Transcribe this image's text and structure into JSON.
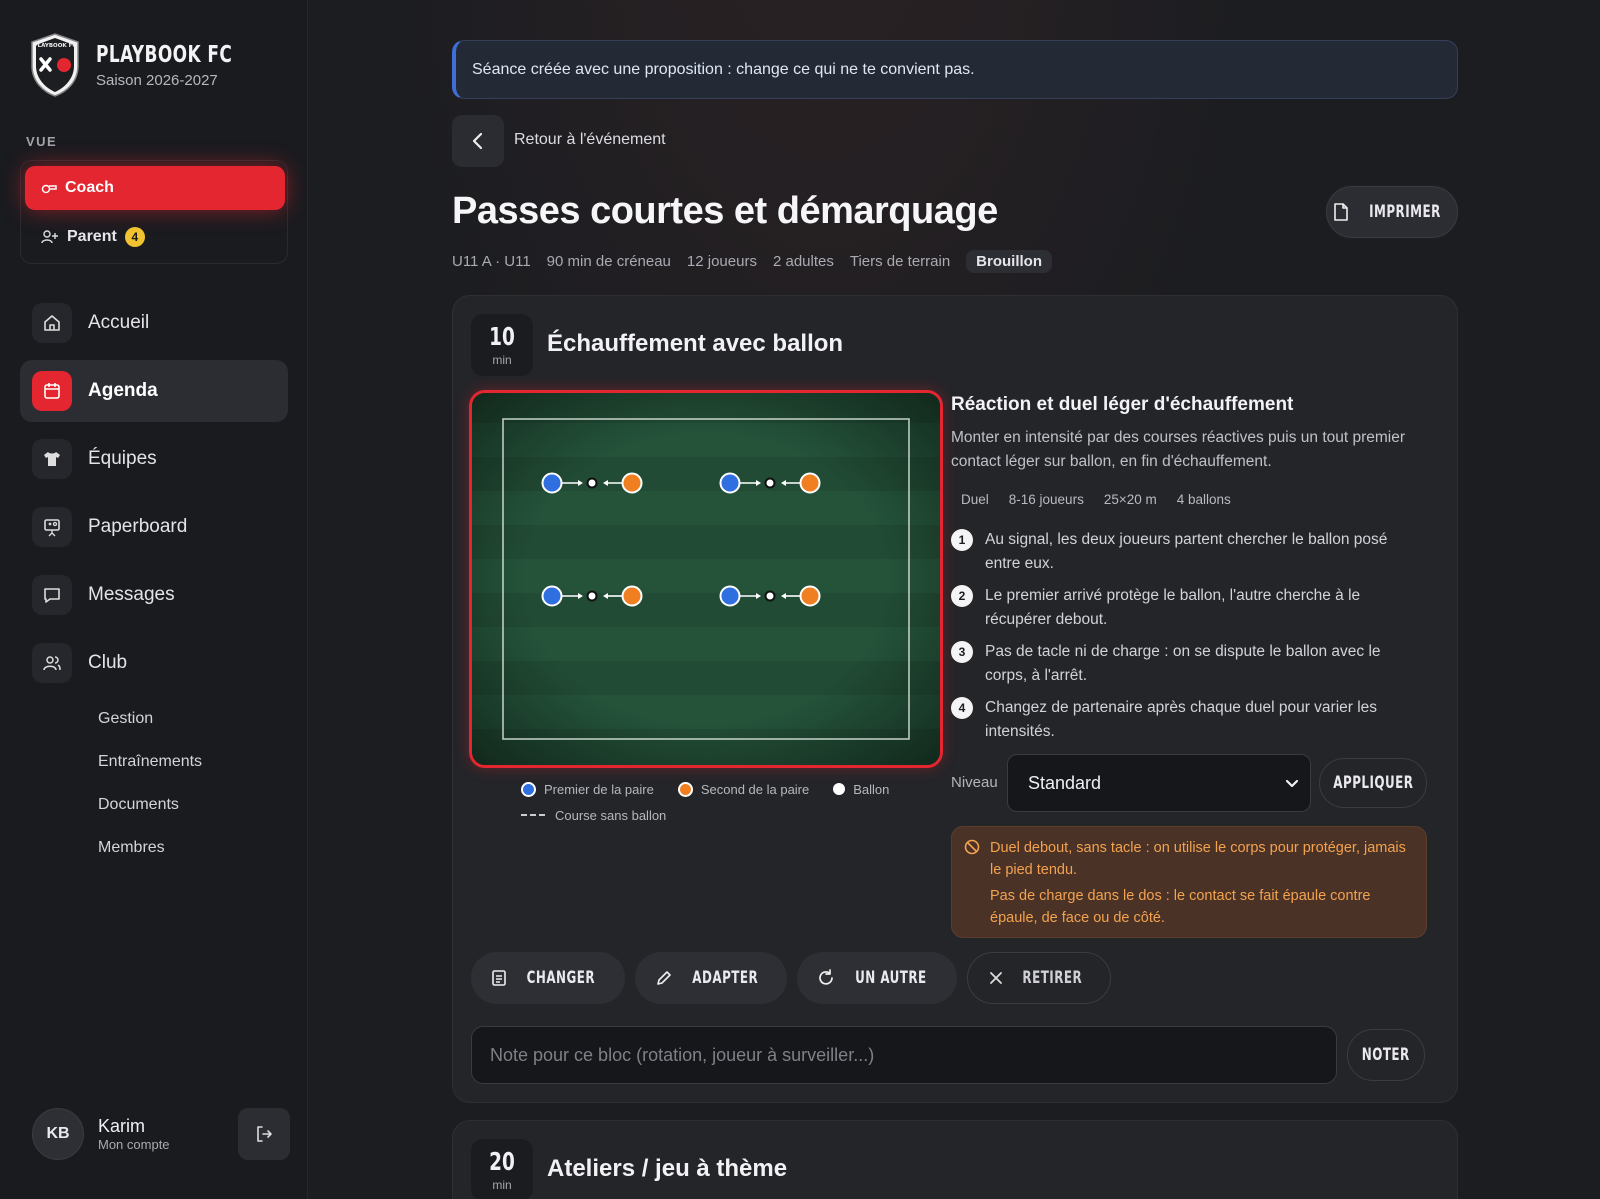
{
  "brand": {
    "name": "PLAYBOOK FC",
    "season": "Saison 2026-2027",
    "logo_text": "PLAYBOOK FC"
  },
  "sidebar": {
    "view_label": "VUE",
    "roles": [
      {
        "label": "Coach",
        "icon": "whistle-icon"
      },
      {
        "label": "Parent",
        "icon": "user-plus-icon",
        "badge": "4"
      }
    ],
    "nav": [
      {
        "label": "Accueil",
        "icon": "home-icon"
      },
      {
        "label": "Agenda",
        "icon": "calendar-icon"
      },
      {
        "label": "Équipes",
        "icon": "shirt-icon"
      },
      {
        "label": "Paperboard",
        "icon": "board-icon"
      },
      {
        "label": "Messages",
        "icon": "chat-icon"
      },
      {
        "label": "Club",
        "icon": "users-icon"
      }
    ],
    "subnav": [
      "Gestion",
      "Entraînements",
      "Documents",
      "Membres"
    ],
    "user": {
      "initials": "KB",
      "name": "Karim",
      "sub": "Mon compte"
    }
  },
  "banner": {
    "text": "Séance créée avec une proposition : change ce qui ne te convient pas."
  },
  "back": {
    "label": "Retour à l'événement"
  },
  "page": {
    "title": "Passes courtes et démarquage",
    "print_label": "IMPRIMER",
    "meta": [
      "U11 A · U11",
      "90 min de créneau",
      "12 joueurs",
      "2 adultes",
      "Tiers de terrain"
    ],
    "status": "Brouillon"
  },
  "block1": {
    "duration": "10",
    "unit": "min",
    "title": "Échauffement avec ballon",
    "exercise": {
      "title": "Réaction et duel léger d'échauffement",
      "description": "Monter en intensité par des courses réactives puis un tout premier contact léger sur ballon, en fin d'échauffement.",
      "tags": [
        "Duel",
        "8-16 joueurs",
        "25×20 m",
        "4 ballons"
      ],
      "steps": [
        {
          "num": "1",
          "text": "Au signal, les deux joueurs partent chercher le ballon posé entre eux."
        },
        {
          "num": "2",
          "text": "Le premier arrivé protège le ballon, l'autre cherche à le récupérer debout."
        },
        {
          "num": "3",
          "text": "Pas de tacle ni de charge : on se dispute le ballon avec le corps, à l'arrêt."
        },
        {
          "num": "4",
          "text": "Changez de partenaire après chaque duel pour varier les intensités."
        }
      ]
    },
    "legend": {
      "first": "Premier de la paire",
      "second": "Second de la paire",
      "ball": "Ballon",
      "run": "Course sans ballon"
    },
    "level": {
      "label": "Niveau",
      "value": "Standard",
      "apply": "APPLIQUER"
    },
    "warnings": [
      "Duel debout, sans tacle : on utilise le corps pour protéger, jamais le pied tendu.",
      "Pas de charge dans le dos : le contact se fait épaule contre épaule, de face ou de côté."
    ],
    "actions": [
      "CHANGER",
      "ADAPTER",
      "UN AUTRE",
      "RETIRER"
    ],
    "note": {
      "placeholder": "Note pour ce bloc (rotation, joueur à surveiller...)",
      "button": "NOTER"
    }
  },
  "block2": {
    "duration": "20",
    "unit": "min",
    "title": "Ateliers / jeu à thème"
  },
  "colors": {
    "accent": "#e3262f",
    "blue_player": "#2f6fe0",
    "orange_player": "#f07f22",
    "pitch": "#1f4a33",
    "warning_text": "#f3a24f"
  }
}
